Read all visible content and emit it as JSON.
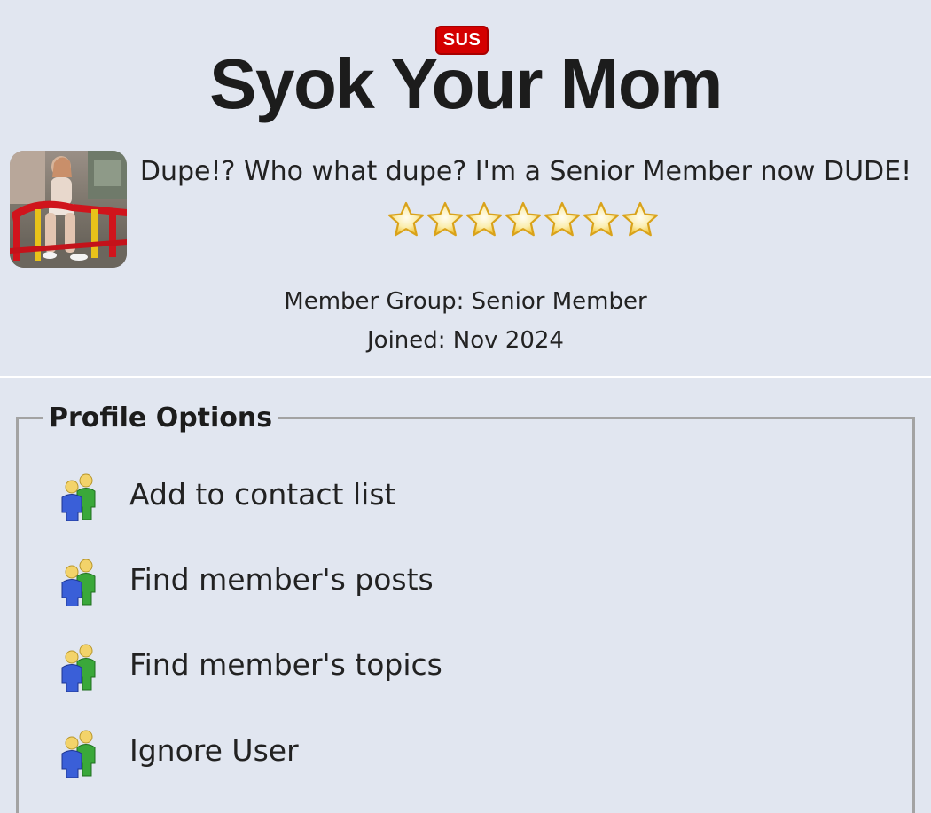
{
  "profile": {
    "badge": "SUS",
    "username": "Syok Your Mom",
    "tagline": "Dupe!? Who what dupe? I'm a Senior Member now DUDE!",
    "star_rating": 7,
    "member_group": "Member Group: Senior Member",
    "joined": "Joined: Nov 2024"
  },
  "options": {
    "title": "Profile Options",
    "items": [
      {
        "label": "Add to contact list",
        "icon": "members-icon"
      },
      {
        "label": "Find member's posts",
        "icon": "members-icon"
      },
      {
        "label": "Find member's topics",
        "icon": "members-icon"
      },
      {
        "label": "Ignore User",
        "icon": "members-icon"
      }
    ]
  },
  "colors": {
    "background": "#e1e6f0",
    "badge": "#d40000",
    "star": "#f2c230",
    "border": "#a3a3a3"
  }
}
